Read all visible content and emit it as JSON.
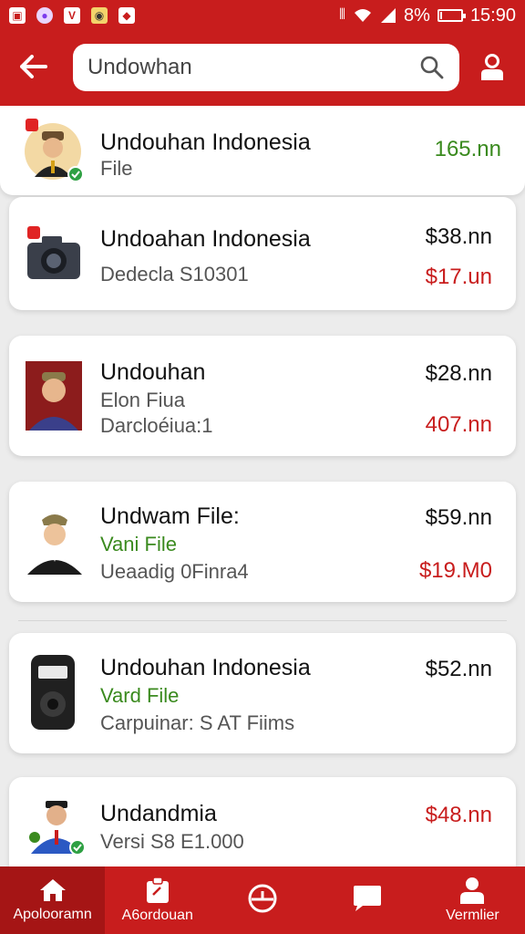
{
  "status_bar": {
    "time": "15:90",
    "battery": "8%",
    "battery_level": 0.08,
    "left_icons": [
      "app-icon",
      "avatar-icon",
      "v-icon",
      "camera-icon",
      "shield-icon"
    ],
    "right_icons": [
      "vibrate-icon",
      "wifi-icon",
      "signal-icon",
      "battery-icon"
    ]
  },
  "header": {
    "search_value": "Undowhan",
    "accent": "#c81d1d"
  },
  "items": [
    {
      "title": "Undouhan Indonesia",
      "sub1": "File",
      "sub2": "",
      "price1": "165.nn",
      "price2": "",
      "thumb": "person-avatar-icon"
    },
    {
      "title": "Undoahan Indonesia",
      "sub1": "Dedecla S10301",
      "sub2": "",
      "price1": "$38.nn",
      "price2": "$17.un",
      "thumb": "camera-icon"
    },
    {
      "title": "Undouhan",
      "sub1": "Elon Fiua",
      "sub2": "Darcloéiua:1",
      "price1": "$28.nn",
      "price2": "407.nn",
      "thumb": "person-avatar-icon"
    },
    {
      "title": "Undwam File:",
      "sub1": "Vani File",
      "sub2": "Ueaadig 0Finra4",
      "price1": "$59.nn",
      "price2": "$19.M0",
      "thumb": "person-avatar-icon"
    },
    {
      "title": "Undouhan Indonesia",
      "sub1": "Vard File",
      "sub2": "Carpuinar: S AT Fiims",
      "price1": "$52.nn",
      "price2": "",
      "thumb": "device-icon"
    },
    {
      "title": "Undandmia",
      "sub1": "Versi S8 E1.000",
      "sub2": "",
      "price1": "$48.nn",
      "price2": "",
      "thumb": "person-avatar-icon"
    }
  ],
  "bottom_nav": [
    {
      "label": "Apolooramn",
      "icon": "home-icon"
    },
    {
      "label": "A6ordouan",
      "icon": "clipboard-icon"
    },
    {
      "label": "",
      "icon": "clock-icon"
    },
    {
      "label": "",
      "icon": "chat-icon"
    },
    {
      "label": "Vermlier",
      "icon": "profile-icon"
    }
  ]
}
